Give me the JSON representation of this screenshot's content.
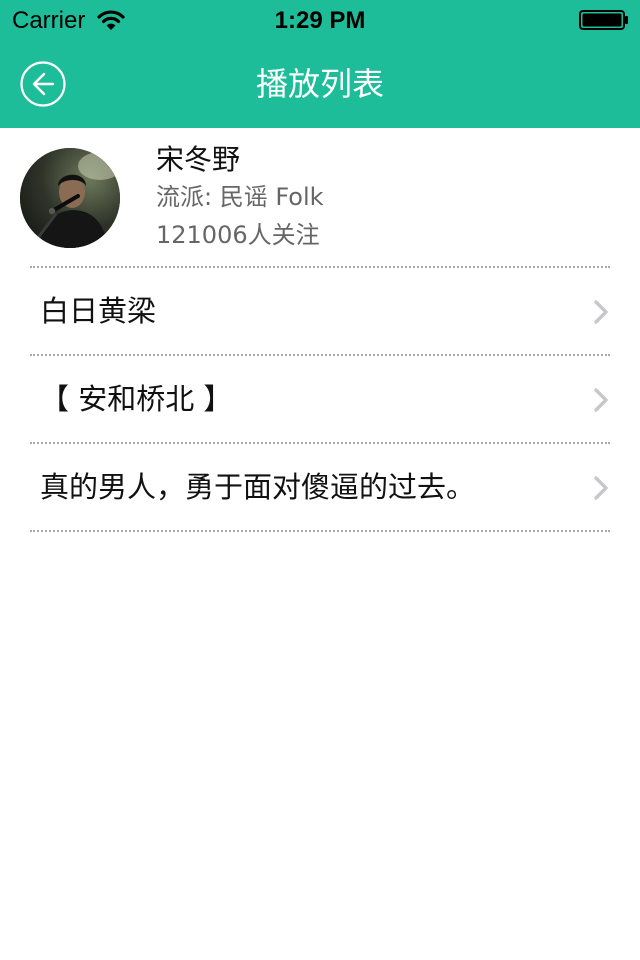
{
  "status_bar": {
    "carrier": "Carrier",
    "time": "1:29 PM"
  },
  "nav": {
    "title": "播放列表",
    "back_icon": "circle-back-arrow"
  },
  "artist": {
    "name": "宋冬野",
    "genre": "流派: 民谣 Folk",
    "followers": "121006人关注"
  },
  "playlists": [
    {
      "label": "白日黄梁"
    },
    {
      "label": "【 安和桥北 】"
    },
    {
      "label": "真的男人，勇于面对傻逼的过去。"
    }
  ],
  "colors": {
    "accent": "#1dbd99",
    "divider": "#a9a9a9",
    "chevron": "#c7c7cc"
  }
}
